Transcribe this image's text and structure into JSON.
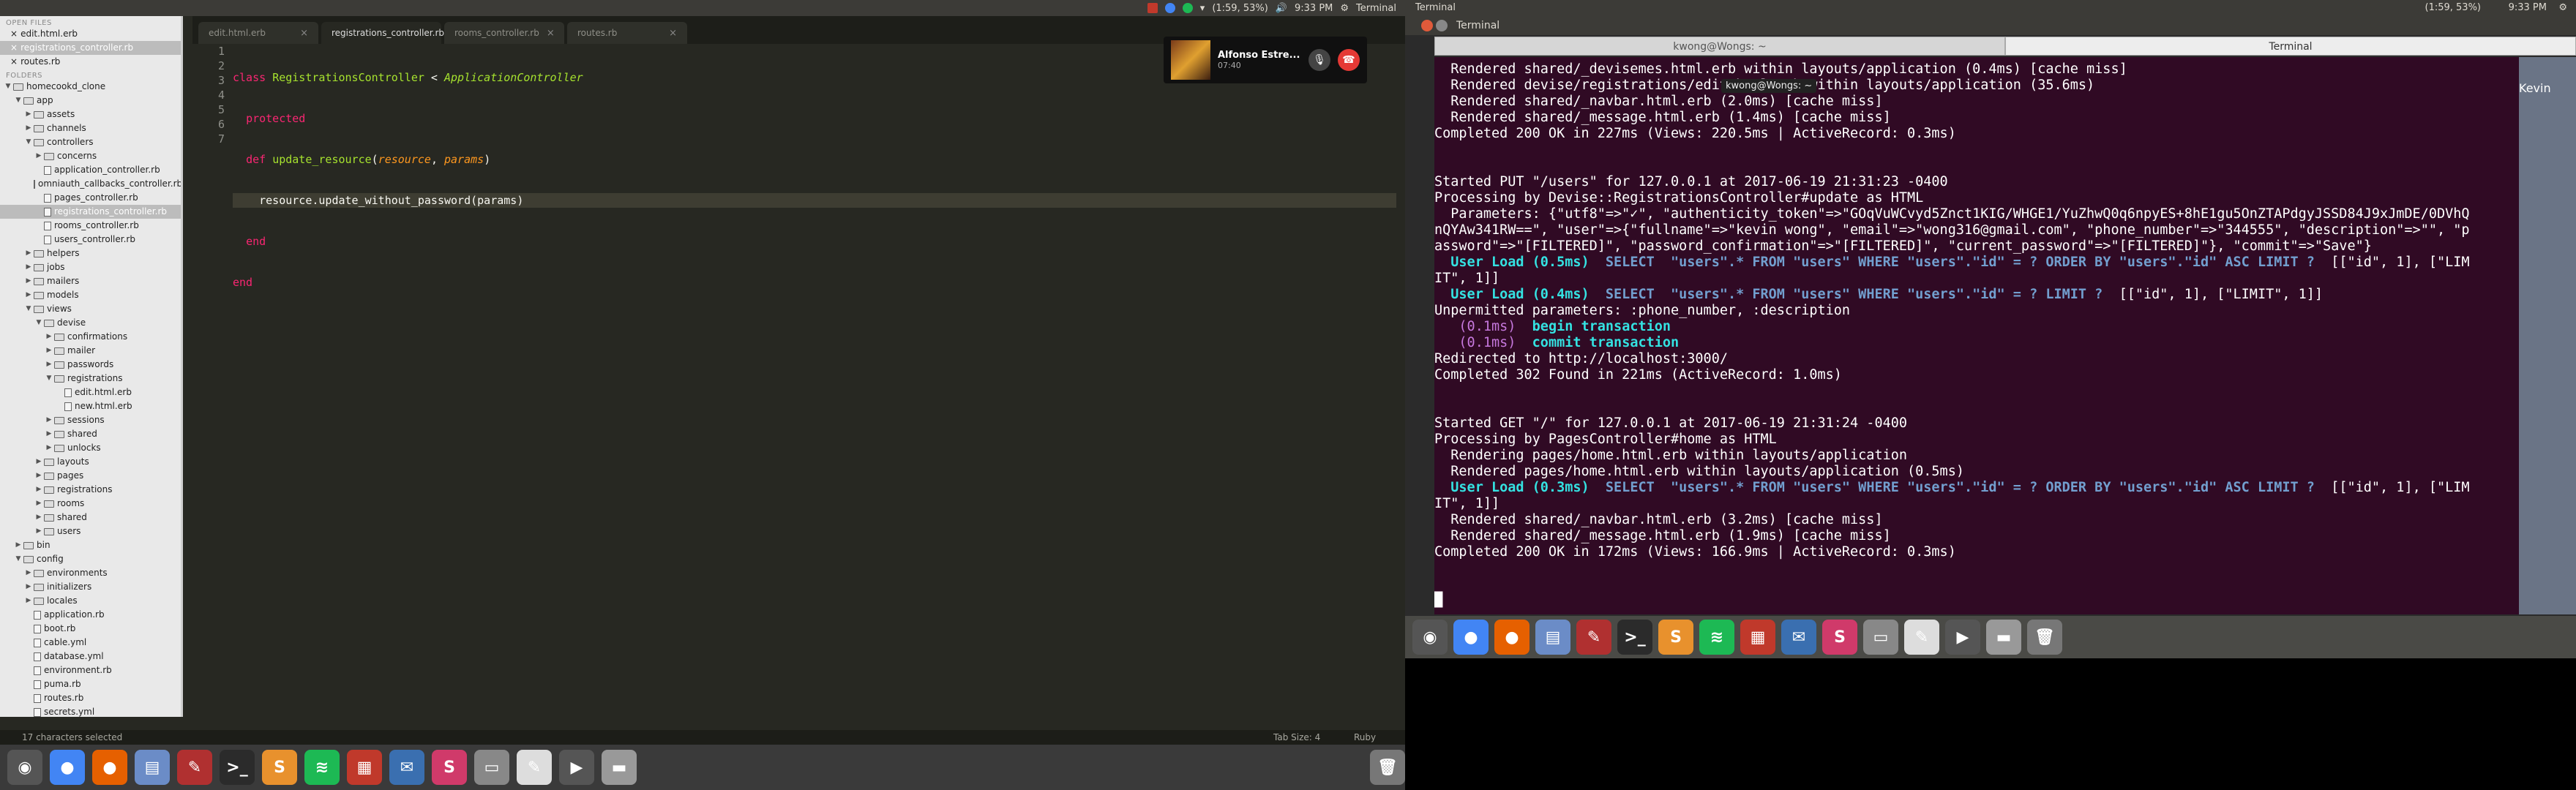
{
  "left_screen": {
    "topbar": {
      "time": "9:33 PM",
      "battery": "(1:59, 53%)",
      "app_title": "Terminal"
    },
    "sidebar": {
      "open_files_header": "OPEN FILES",
      "open_files": [
        "edit.html.erb",
        "registrations_controller.rb",
        "routes.rb"
      ],
      "folders_header": "FOLDERS",
      "tree": [
        {
          "label": "homecookd_clone",
          "depth": 0,
          "kind": "folder",
          "open": true
        },
        {
          "label": "app",
          "depth": 1,
          "kind": "folder",
          "open": true
        },
        {
          "label": "assets",
          "depth": 2,
          "kind": "folder",
          "open": false
        },
        {
          "label": "channels",
          "depth": 2,
          "kind": "folder",
          "open": false
        },
        {
          "label": "controllers",
          "depth": 2,
          "kind": "folder",
          "open": true
        },
        {
          "label": "concerns",
          "depth": 3,
          "kind": "folder",
          "open": false
        },
        {
          "label": "application_controller.rb",
          "depth": 3,
          "kind": "file"
        },
        {
          "label": "omniauth_callbacks_controller.rb",
          "depth": 3,
          "kind": "file"
        },
        {
          "label": "pages_controller.rb",
          "depth": 3,
          "kind": "file"
        },
        {
          "label": "registrations_controller.rb",
          "depth": 3,
          "kind": "file",
          "selected": true
        },
        {
          "label": "rooms_controller.rb",
          "depth": 3,
          "kind": "file"
        },
        {
          "label": "users_controller.rb",
          "depth": 3,
          "kind": "file"
        },
        {
          "label": "helpers",
          "depth": 2,
          "kind": "folder",
          "open": false
        },
        {
          "label": "jobs",
          "depth": 2,
          "kind": "folder",
          "open": false
        },
        {
          "label": "mailers",
          "depth": 2,
          "kind": "folder",
          "open": false
        },
        {
          "label": "models",
          "depth": 2,
          "kind": "folder",
          "open": false
        },
        {
          "label": "views",
          "depth": 2,
          "kind": "folder",
          "open": true
        },
        {
          "label": "devise",
          "depth": 3,
          "kind": "folder",
          "open": true
        },
        {
          "label": "confirmations",
          "depth": 4,
          "kind": "folder",
          "open": false
        },
        {
          "label": "mailer",
          "depth": 4,
          "kind": "folder",
          "open": false
        },
        {
          "label": "passwords",
          "depth": 4,
          "kind": "folder",
          "open": false
        },
        {
          "label": "registrations",
          "depth": 4,
          "kind": "folder",
          "open": true
        },
        {
          "label": "edit.html.erb",
          "depth": 5,
          "kind": "file"
        },
        {
          "label": "new.html.erb",
          "depth": 5,
          "kind": "file"
        },
        {
          "label": "sessions",
          "depth": 4,
          "kind": "folder",
          "open": false
        },
        {
          "label": "shared",
          "depth": 4,
          "kind": "folder",
          "open": false
        },
        {
          "label": "unlocks",
          "depth": 4,
          "kind": "folder",
          "open": false
        },
        {
          "label": "layouts",
          "depth": 3,
          "kind": "folder",
          "open": false
        },
        {
          "label": "pages",
          "depth": 3,
          "kind": "folder",
          "open": false
        },
        {
          "label": "registrations",
          "depth": 3,
          "kind": "folder",
          "open": false
        },
        {
          "label": "rooms",
          "depth": 3,
          "kind": "folder",
          "open": false
        },
        {
          "label": "shared",
          "depth": 3,
          "kind": "folder",
          "open": false
        },
        {
          "label": "users",
          "depth": 3,
          "kind": "folder",
          "open": false
        },
        {
          "label": "bin",
          "depth": 1,
          "kind": "folder",
          "open": false
        },
        {
          "label": "config",
          "depth": 1,
          "kind": "folder",
          "open": true
        },
        {
          "label": "environments",
          "depth": 2,
          "kind": "folder",
          "open": false
        },
        {
          "label": "initializers",
          "depth": 2,
          "kind": "folder",
          "open": false
        },
        {
          "label": "locales",
          "depth": 2,
          "kind": "folder",
          "open": false
        },
        {
          "label": "application.rb",
          "depth": 2,
          "kind": "file"
        },
        {
          "label": "boot.rb",
          "depth": 2,
          "kind": "file"
        },
        {
          "label": "cable.yml",
          "depth": 2,
          "kind": "file"
        },
        {
          "label": "database.yml",
          "depth": 2,
          "kind": "file"
        },
        {
          "label": "environment.rb",
          "depth": 2,
          "kind": "file"
        },
        {
          "label": "puma.rb",
          "depth": 2,
          "kind": "file"
        },
        {
          "label": "routes.rb",
          "depth": 2,
          "kind": "file"
        },
        {
          "label": "secrets.yml",
          "depth": 2,
          "kind": "file"
        }
      ]
    },
    "tabs": [
      {
        "label": "edit.html.erb",
        "active": false
      },
      {
        "label": "registrations_controller.rb",
        "active": true
      },
      {
        "label": "rooms_controller.rb",
        "active": false
      },
      {
        "label": "routes.rb",
        "active": false
      }
    ],
    "line_numbers": [
      "1",
      "2",
      "3",
      "4",
      "5",
      "6",
      "7"
    ],
    "call": {
      "name": "Alfonso Estre...",
      "duration": "07:40"
    },
    "status": {
      "selection": "17 characters selected",
      "tab_size": "Tab Size: 4",
      "syntax": "Ruby"
    }
  },
  "right_screen": {
    "topbar": {
      "app_title": "Terminal",
      "battery": "(1:59, 53%)",
      "time": "9:33 PM",
      "user": "Kevin"
    },
    "terminal": {
      "window_title": "Terminal",
      "tab_titles": [
        "kwong@Wongs: ~",
        "Terminal"
      ],
      "tooltip": "kwong@Wongs: ~",
      "lines": [
        {
          "t": "  Rendered shared/_devisemes.html.erb within layouts/application (0.4ms) [cache miss]"
        },
        {
          "t": "  Rendered devise/registrations/edit.html.erb within layouts/application (35.6ms)"
        },
        {
          "t": "  Rendered shared/_navbar.html.erb (2.0ms) [cache miss]"
        },
        {
          "t": "  Rendered shared/_message.html.erb (1.4ms) [cache miss]"
        },
        {
          "t": "Completed 200 OK in 227ms (Views: 220.5ms | ActiveRecord: 0.3ms)"
        },
        {
          "t": ""
        },
        {
          "t": ""
        },
        {
          "t": "Started PUT \"/users\" for 127.0.0.1 at 2017-06-19 21:31:23 -0400"
        },
        {
          "t": "Processing by Devise::RegistrationsController#update as HTML"
        },
        {
          "t": "  Parameters: {\"utf8\"=>\"✓\", \"authenticity_token\"=>\"GOqVuWCvyd5Znct1KIG/WHGE1/YuZhwQ0q6npyES+8hE1gu5OnZTAPdgyJSSD84J9xJmDE/0DVhQ"
        },
        {
          "t": "nQYAw341RW==\", \"user\"=>{\"fullname\"=>\"kevin wong\", \"email\"=>\"wong316@gmail.com\", \"phone_number\"=>\"344555\", \"description\"=>\"\", \"p"
        },
        {
          "t": "assword\"=>\"[FILTERED]\", \"password_confirmation\"=>\"[FILTERED]\", \"current_password\"=>\"[FILTERED]\"}, \"commit\"=>\"Save\"}"
        },
        {
          "t": "  User Load (0.5ms)  SELECT  \"users\".* FROM \"users\" WHERE \"users\".\"id\" = ? ORDER BY \"users\".\"id\" ASC LIMIT ?  [[\"id\", 1], [\"LIM",
          "style": "sql"
        },
        {
          "t": "IT\", 1]]"
        },
        {
          "t": "  User Load (0.4ms)  SELECT  \"users\".* FROM \"users\" WHERE \"users\".\"id\" = ? LIMIT ?  [[\"id\", 1], [\"LIMIT\", 1]]",
          "style": "sql"
        },
        {
          "t": "Unpermitted parameters: :phone_number, :description"
        },
        {
          "t": "   (0.1ms)  begin transaction",
          "style": "tx"
        },
        {
          "t": "   (0.1ms)  commit transaction",
          "style": "tx"
        },
        {
          "t": "Redirected to http://localhost:3000/"
        },
        {
          "t": "Completed 302 Found in 221ms (ActiveRecord: 1.0ms)"
        },
        {
          "t": ""
        },
        {
          "t": ""
        },
        {
          "t": "Started GET \"/\" for 127.0.0.1 at 2017-06-19 21:31:24 -0400"
        },
        {
          "t": "Processing by PagesController#home as HTML"
        },
        {
          "t": "  Rendering pages/home.html.erb within layouts/application"
        },
        {
          "t": "  Rendered pages/home.html.erb within layouts/application (0.5ms)"
        },
        {
          "t": "  User Load (0.3ms)  SELECT  \"users\".* FROM \"users\" WHERE \"users\".\"id\" = ? ORDER BY \"users\".\"id\" ASC LIMIT ?  [[\"id\", 1], [\"LIM",
          "style": "sql"
        },
        {
          "t": "IT\", 1]]"
        },
        {
          "t": "  Rendered shared/_navbar.html.erb (3.2ms) [cache miss]"
        },
        {
          "t": "  Rendered shared/_message.html.erb (1.9ms) [cache miss]"
        },
        {
          "t": "Completed 200 OK in 172ms (Views: 166.9ms | ActiveRecord: 0.3ms)"
        },
        {
          "t": ""
        },
        {
          "t": ""
        },
        {
          "t": "█"
        }
      ]
    }
  },
  "launcher_icons": [
    "dash-icon",
    "chrome-icon",
    "firefox-icon",
    "files-icon",
    "settings-icon",
    "terminal-icon",
    "sublime-icon",
    "spotify-icon",
    "calendar-icon",
    "thunderbird-icon",
    "slack-icon",
    "storage-icon",
    "editor-icon",
    "video-icon",
    "drive-icon",
    "trash-icon"
  ],
  "colors": {
    "monokai_bg": "#272822",
    "terminal_bg": "#300a24",
    "keyword": "#f92672",
    "class": "#a6e22e",
    "param": "#fd971f"
  }
}
